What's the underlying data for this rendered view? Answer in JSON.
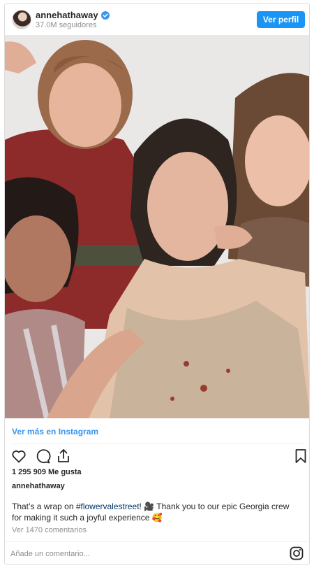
{
  "header": {
    "username": "annehathaway",
    "followers": "37.0M seguidores",
    "profile_button": "Ver perfil"
  },
  "post": {
    "see_more": "Ver más en Instagram",
    "likes": "1 295 909 Me gusta",
    "author": "annehathaway",
    "caption_before": "That’s a wrap on ",
    "hashtag": "#flowervalestreet",
    "caption_after": "! 🎥 Thank you to our epic Georgia crew for making it such a joyful experience 🥰",
    "comments": "Ver 1470 comentarios",
    "comment_placeholder": "Añade un comentario..."
  },
  "icons": {
    "like": "heart-icon",
    "comment": "comment-icon",
    "share": "share-icon",
    "save": "bookmark-icon",
    "brand": "instagram-icon",
    "verified": "verified-badge-icon"
  },
  "colors": {
    "accent": "#1a95f5",
    "link": "#3897f0",
    "muted": "#8e8e8e",
    "hashtag": "#003569"
  }
}
